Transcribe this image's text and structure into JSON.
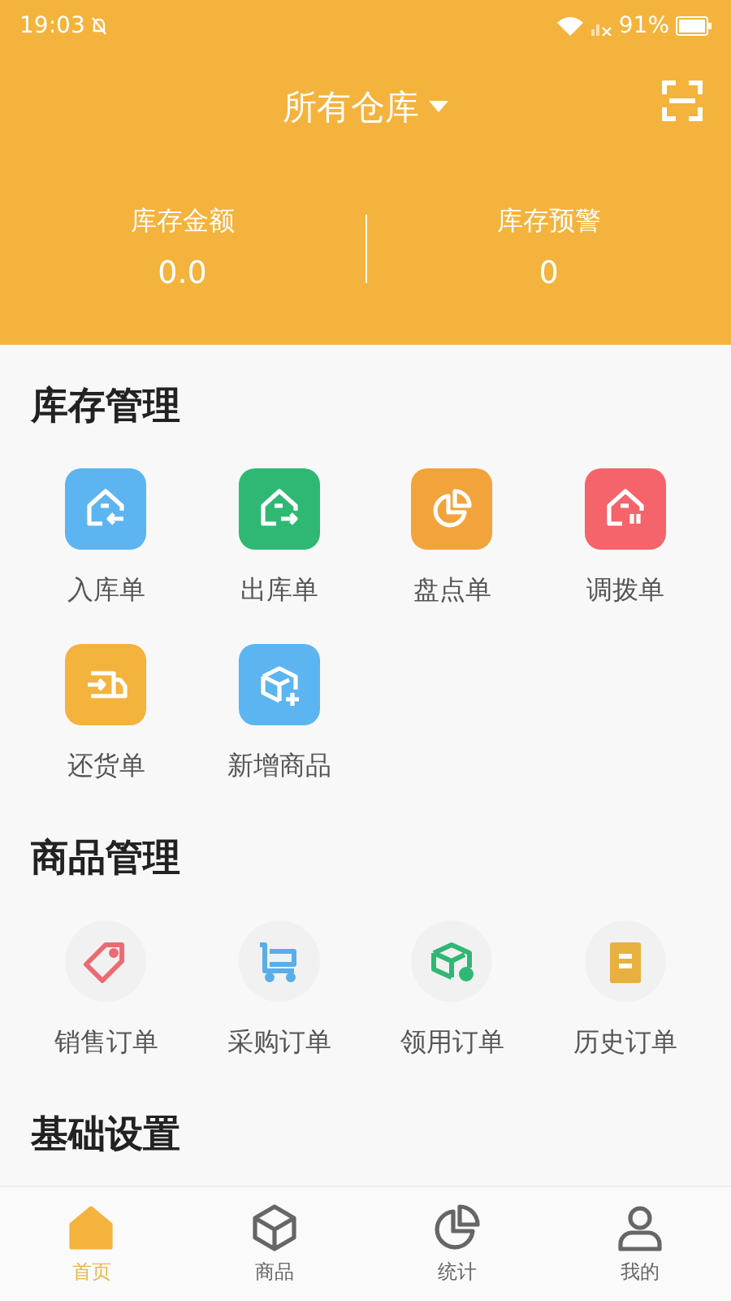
{
  "status_bar": {
    "time": "19:03",
    "battery": "91%"
  },
  "header": {
    "warehouse": "所有仓库",
    "stats": [
      {
        "label": "库存金额",
        "value": "0.0"
      },
      {
        "label": "库存预警",
        "value": "0"
      }
    ]
  },
  "sections": [
    {
      "title": "库存管理",
      "kind": "tile",
      "items": [
        {
          "label": "入库单",
          "color": "#5cb5f0"
        },
        {
          "label": "出库单",
          "color": "#2fb874"
        },
        {
          "label": "盘点单",
          "color": "#f2a33c"
        },
        {
          "label": "调拨单",
          "color": "#f5636b"
        },
        {
          "label": "还货单",
          "color": "#f3b33d"
        },
        {
          "label": "新增商品",
          "color": "#5cb5f0"
        }
      ]
    },
    {
      "title": "商品管理",
      "kind": "circle",
      "items": [
        {
          "label": "销售订单",
          "color": "#ec6a72"
        },
        {
          "label": "采购订单",
          "color": "#5aaee8"
        },
        {
          "label": "领用订单",
          "color": "#2fb874"
        },
        {
          "label": "历史订单",
          "color": "#e8b03e"
        }
      ]
    },
    {
      "title": "基础设置"
    }
  ],
  "tab_bar": [
    {
      "label": "首页",
      "selected": true
    },
    {
      "label": "商品",
      "selected": false
    },
    {
      "label": "统计",
      "selected": false
    },
    {
      "label": "我的",
      "selected": false
    }
  ]
}
